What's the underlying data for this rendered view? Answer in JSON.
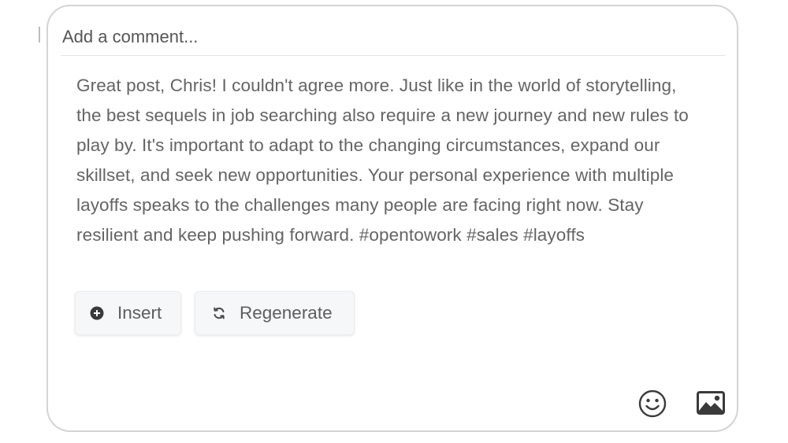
{
  "comment_input": {
    "placeholder": "Add a comment..."
  },
  "suggestion": {
    "text": "Great post, Chris! I couldn't agree more. Just like in the world of storytelling, the best sequels in job searching also require a new journey and new rules to play by. It's important to adapt to the changing circumstances, expand our skillset, and seek new opportunities. Your personal experience with multiple layoffs speaks to the challenges many people are facing right now. Stay resilient and keep pushing forward. #opentowork #sales #layoffs"
  },
  "actions": {
    "insert_label": "Insert",
    "insert_icon": "plus-circle-icon",
    "regenerate_label": "Regenerate",
    "regenerate_icon": "refresh-icon"
  },
  "toolbar": {
    "emoji_icon": "emoji-icon",
    "image_icon": "image-icon"
  },
  "colors": {
    "border": "#d4d4d4",
    "text": "#646464",
    "button_bg": "#f6f7f8",
    "icon": "#3a3a3a"
  }
}
